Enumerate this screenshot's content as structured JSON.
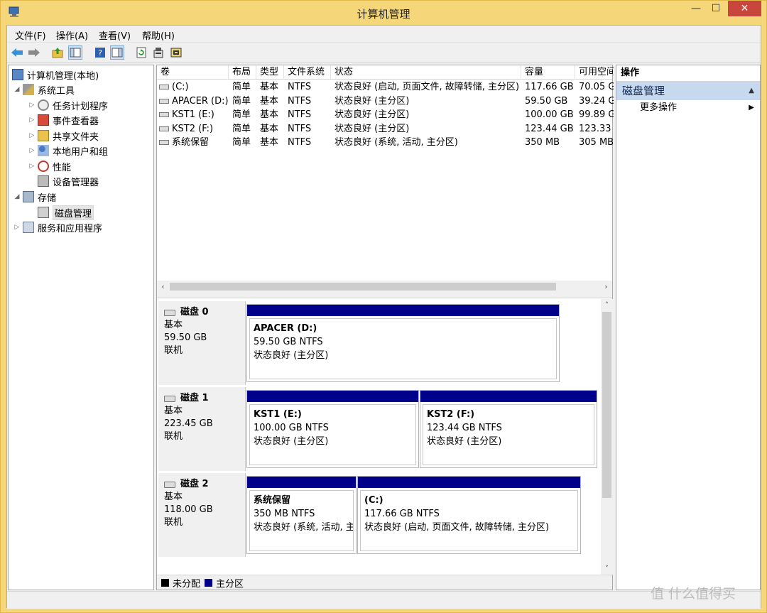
{
  "window": {
    "title": "计算机管理",
    "min": "—",
    "max": "☐",
    "close": "✕"
  },
  "menu": [
    "文件(F)",
    "操作(A)",
    "查看(V)",
    "帮助(H)"
  ],
  "tree": {
    "root": "计算机管理(本地)",
    "system_tools": "系统工具",
    "task_scheduler": "任务计划程序",
    "event_viewer": "事件查看器",
    "shared_folders": "共享文件夹",
    "local_users": "本地用户和组",
    "performance": "性能",
    "device_manager": "设备管理器",
    "storage": "存储",
    "disk_management": "磁盘管理",
    "services_apps": "服务和应用程序"
  },
  "volume_list": {
    "headers": [
      "卷",
      "布局",
      "类型",
      "文件系统",
      "状态",
      "容量",
      "可用空间"
    ],
    "rows": [
      [
        "(C:)",
        "简单",
        "基本",
        "NTFS",
        "状态良好 (启动, 页面文件, 故障转储, 主分区)",
        "117.66 GB",
        "70.05 G"
      ],
      [
        "APACER (D:)",
        "简单",
        "基本",
        "NTFS",
        "状态良好 (主分区)",
        "59.50 GB",
        "39.24 G"
      ],
      [
        "KST1 (E:)",
        "简单",
        "基本",
        "NTFS",
        "状态良好 (主分区)",
        "100.00 GB",
        "99.89 G"
      ],
      [
        "KST2 (F:)",
        "简单",
        "基本",
        "NTFS",
        "状态良好 (主分区)",
        "123.44 GB",
        "123.33"
      ],
      [
        "系统保留",
        "简单",
        "基本",
        "NTFS",
        "状态良好 (系统, 活动, 主分区)",
        "350 MB",
        "305 MB"
      ]
    ]
  },
  "disks": [
    {
      "name": "磁盘 0",
      "type": "基本",
      "size": "59.50 GB",
      "status": "联机",
      "partitions": [
        {
          "name": "APACER (D:)",
          "size": "59.50 GB NTFS",
          "status": "状态良好 (主分区)"
        }
      ]
    },
    {
      "name": "磁盘 1",
      "type": "基本",
      "size": "223.45 GB",
      "status": "联机",
      "partitions": [
        {
          "name": "KST1 (E:)",
          "size": "100.00 GB NTFS",
          "status": "状态良好 (主分区)"
        },
        {
          "name": "KST2 (F:)",
          "size": "123.44 GB NTFS",
          "status": "状态良好 (主分区)"
        }
      ]
    },
    {
      "name": "磁盘 2",
      "type": "基本",
      "size": "118.00 GB",
      "status": "联机",
      "partitions": [
        {
          "name": "系统保留",
          "size": "350 MB NTFS",
          "status": "状态良好 (系统, 活动, 主"
        },
        {
          "name": "(C:)",
          "size": "117.66 GB NTFS",
          "status": "状态良好 (启动, 页面文件, 故障转储, 主分区)"
        }
      ]
    }
  ],
  "legend": {
    "unallocated": "未分配",
    "primary": "主分区",
    "unallocated_color": "#000000",
    "primary_color": "#00008b"
  },
  "actions": {
    "header": "操作",
    "section": "磁盘管理",
    "more": "更多操作"
  },
  "watermark": "值 什么值得买"
}
